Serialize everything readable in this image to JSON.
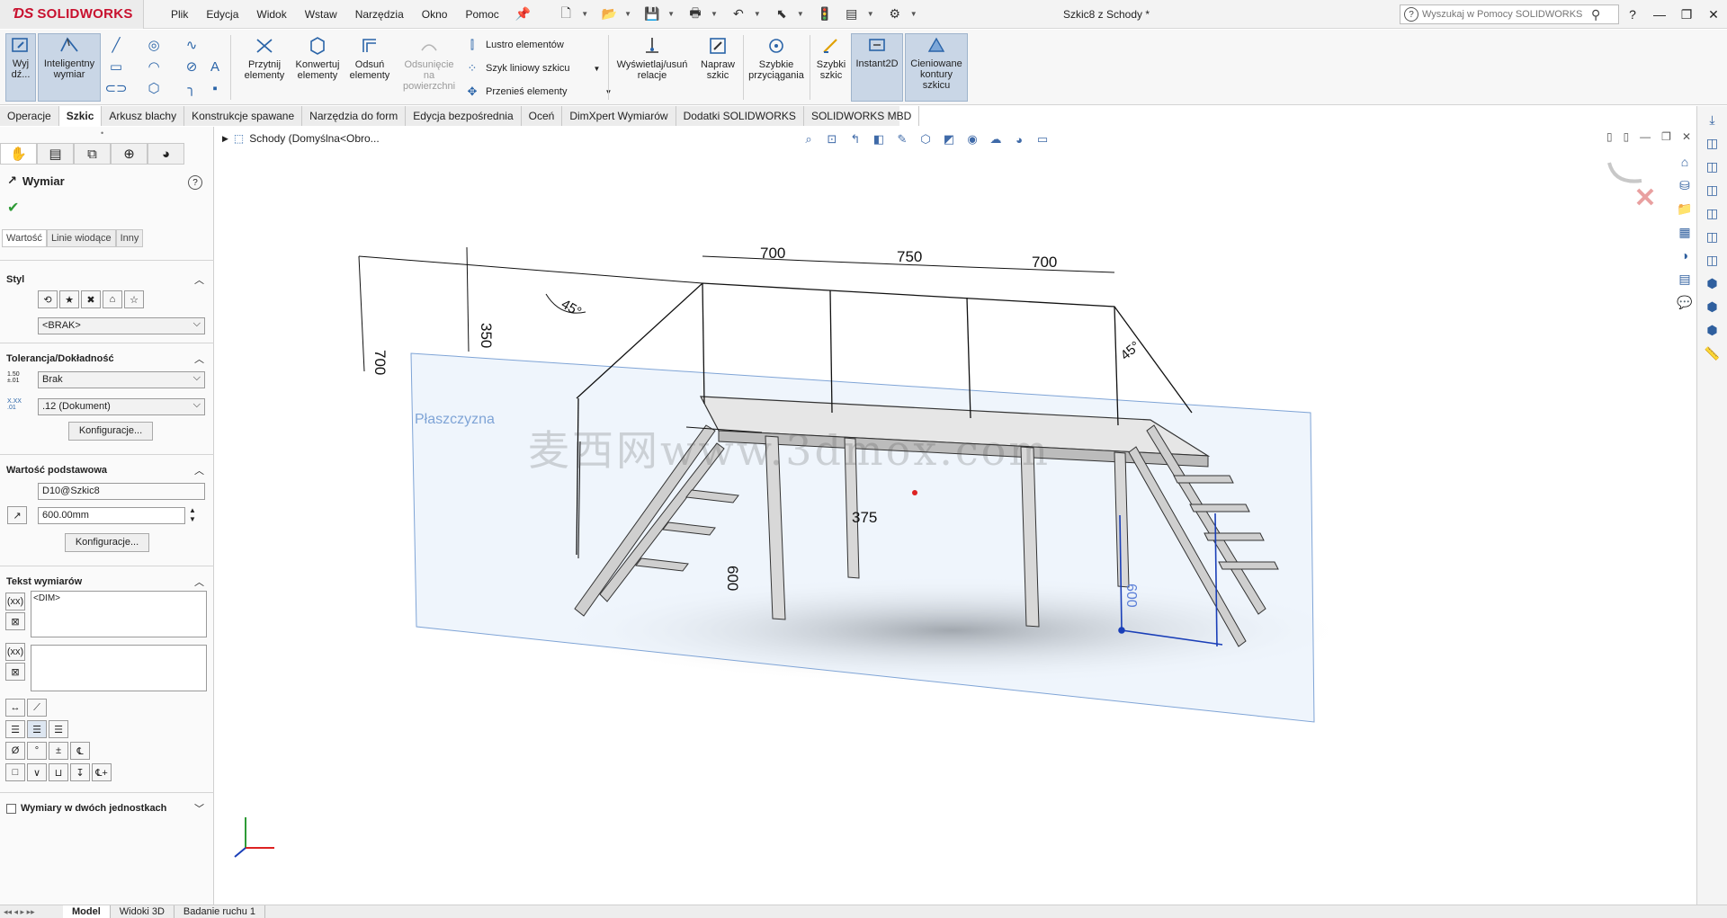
{
  "app": {
    "logo_ds": "ƊS",
    "logo_name": "SOLIDWORKS",
    "doc_title": "Szkic8 z Schody *",
    "menus": [
      "Plik",
      "Edycja",
      "Widok",
      "Wstaw",
      "Narzędzia",
      "Okno",
      "Pomoc"
    ],
    "search_placeholder": "Wyszukaj w Pomocy SOLIDWORKS"
  },
  "command_manager": {
    "exit_label": "Wyj dź...",
    "smart_dim_label": "Inteligentny wymiar",
    "trim_label": "Przytnij elementy",
    "convert_label": "Konwertuj elementy",
    "offset_label": "Odsuń elementy",
    "offset_surface_label": "Odsunięcie na powierzchni",
    "mirror_label": "Lustro elementów",
    "linear_pattern_label": "Szyk liniowy szkicu",
    "move_label": "Przenieś elementy",
    "relations_label": "Wyświetlaj/usuń relacje",
    "repair_label": "Napraw szkic",
    "snaps_label": "Szybkie przyciągania",
    "rapid_sketch_label": "Szybki szkic",
    "instant2d_label": "Instant2D",
    "shaded_label": "Cieniowane kontury szkicu"
  },
  "tabs": [
    "Operacje",
    "Szkic",
    "Arkusz blachy",
    "Konstrukcje spawane",
    "Narzędzia do form",
    "Edycja bezpośrednia",
    "Oceń",
    "DimXpert Wymiarów",
    "Dodatki SOLIDWORKS",
    "SOLIDWORKS MBD"
  ],
  "property_manager": {
    "title": "Wymiar",
    "subtabs": [
      "Wartość",
      "Linie wiodące",
      "Inny"
    ],
    "style_header": "Styl",
    "style_combo": "<BRAK>",
    "tolerance_header": "Tolerancja/Dokładność",
    "tolerance_combo": "Brak",
    "precision_combo": ".12 (Dokument)",
    "config_button": "Konfiguracje...",
    "primary_header": "Wartość podstawowa",
    "primary_name": "D10@Szkic8",
    "primary_value": "600.00mm",
    "config_button2": "Konfiguracje...",
    "dim_text_header": "Tekst wymiarów",
    "dim_text_value": "<DIM>",
    "dual_label": "Wymiary w dwóch jednostkach"
  },
  "viewport": {
    "tree_label": "Schody  (Domyślna<Obro...",
    "plane_label": "Płaszczyzna",
    "watermark": "麦西网www.3dmox.com",
    "dims": {
      "d1": "700",
      "d2": "750",
      "d3": "700",
      "h1": "700",
      "h2": "350",
      "a1": "45°",
      "a2": "45°",
      "w1": "375",
      "v1": "600",
      "v2": "600"
    }
  },
  "bottom_tabs": [
    "Model",
    "Widoki 3D",
    "Badanie ruchu 1"
  ]
}
